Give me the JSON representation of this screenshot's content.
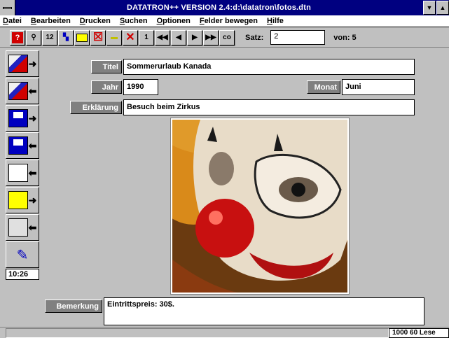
{
  "window": {
    "title": "DATATRON++ VERSION 2.4:d:\\datatron\\fotos.dtn"
  },
  "menu": {
    "items": [
      "Datei",
      "Bearbeiten",
      "Drucken",
      "Suchen",
      "Optionen",
      "Felder bewegen",
      "Hilfe"
    ]
  },
  "toolbar": {
    "btn_query": "?",
    "btn_12": "12",
    "btn_1": "1",
    "btn_co": "co",
    "satz_label": "Satz:",
    "satz_value": "2",
    "von_label": "von: 5"
  },
  "sidebar": {
    "clock": "10:26"
  },
  "form": {
    "titel_label": "Titel",
    "titel_value": "Sommerurlaub Kanada",
    "jahr_label": "Jahr",
    "jahr_value": "1990",
    "monat_label": "Monat",
    "monat_value": "Juni",
    "erklaerung_label": "Erklärung",
    "erklaerung_value": "Besuch beim Zirkus",
    "bemerkung_label": "Bemerkung",
    "bemerkung_value": "Eintrittspreis: 30$."
  },
  "statusbar": {
    "right": "1000 60 Lese"
  },
  "colors": {
    "titlebar": "#000080",
    "face": "#c0c0c0",
    "label_bg": "#808080"
  }
}
